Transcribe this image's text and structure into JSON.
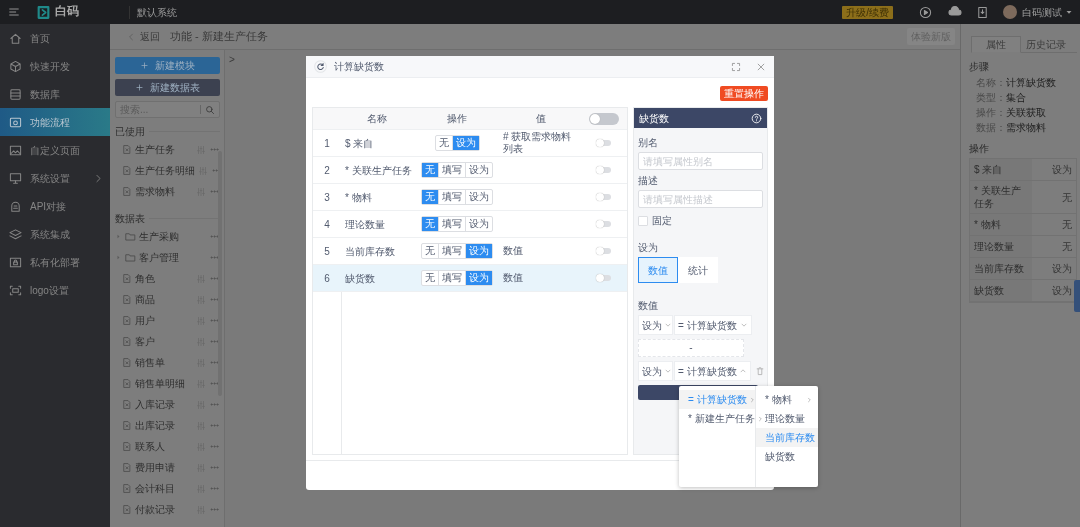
{
  "topbar": {
    "app_name": "白码",
    "system": "默认系统",
    "upgrade": "升级/续费",
    "user": "白码测试"
  },
  "sidebar": {
    "items": [
      {
        "label": "首页",
        "selected": false,
        "kind": "link"
      },
      {
        "label": "快速开发",
        "selected": false,
        "kind": "link"
      },
      {
        "label": "数据库",
        "selected": false,
        "kind": "link"
      },
      {
        "label": "功能流程",
        "selected": true,
        "kind": "link"
      },
      {
        "label": "自定义页面",
        "selected": false,
        "kind": "link"
      },
      {
        "label": "系统设置",
        "selected": false,
        "kind": "group"
      },
      {
        "label": "API对接",
        "selected": false,
        "kind": "link"
      },
      {
        "label": "系统集成",
        "selected": false,
        "kind": "link"
      },
      {
        "label": "私有化部署",
        "selected": false,
        "kind": "link"
      },
      {
        "label": "logo设置",
        "selected": false,
        "kind": "link"
      }
    ]
  },
  "breadcrumb": {
    "back": "返回",
    "title": "功能 - 新建生产任务",
    "action": "体验新版"
  },
  "tree": {
    "buttons": [
      {
        "label": "新建模块",
        "kind": "primary"
      },
      {
        "label": "新建数据表",
        "kind": "dark"
      }
    ],
    "search": {
      "placeholder": "搜索..."
    },
    "sections": [
      {
        "title": "已使用",
        "items": [
          {
            "label": "生产任务",
            "kind": "table"
          },
          {
            "label": "生产任务明细",
            "kind": "table"
          },
          {
            "label": "需求物料",
            "kind": "table"
          }
        ]
      },
      {
        "title": "数据表",
        "items": [
          {
            "label": "生产采购",
            "kind": "folder",
            "expanded": false
          },
          {
            "label": "客户管理",
            "kind": "folder",
            "expanded": false
          },
          {
            "label": "角色",
            "kind": "table"
          },
          {
            "label": "商品",
            "kind": "table"
          },
          {
            "label": "用户",
            "kind": "table"
          },
          {
            "label": "客户",
            "kind": "table"
          },
          {
            "label": "销售单",
            "kind": "table"
          },
          {
            "label": "销售单明细",
            "kind": "table"
          },
          {
            "label": "入库记录",
            "kind": "table"
          },
          {
            "label": "出库记录",
            "kind": "table"
          },
          {
            "label": "联系人",
            "kind": "table"
          },
          {
            "label": "费用申请",
            "kind": "table"
          },
          {
            "label": "会计科目",
            "kind": "table"
          },
          {
            "label": "付款记录",
            "kind": "table"
          }
        ]
      }
    ]
  },
  "canvas": {
    "expand_mark": ">"
  },
  "modal": {
    "title": "计算缺货数",
    "reset": "重置操作",
    "table": {
      "columns": [
        "名称",
        "操作",
        "值"
      ],
      "enabled": false,
      "rows": [
        {
          "index": "1",
          "name": "$ 来自",
          "ops": [
            {
              "label": "无",
              "selected": false
            },
            {
              "label": "设为",
              "selected": true
            }
          ],
          "value": "# 获取需求物料列表",
          "enabled": false,
          "selected": false
        },
        {
          "index": "2",
          "name": "* 关联生产任务",
          "ops": [
            {
              "label": "无",
              "selected": true
            },
            {
              "label": "填写",
              "selected": false
            },
            {
              "label": "设为",
              "selected": false
            }
          ],
          "enabled": false,
          "selected": false
        },
        {
          "index": "3",
          "name": "* 物料",
          "ops": [
            {
              "label": "无",
              "selected": true
            },
            {
              "label": "填写",
              "selected": false
            },
            {
              "label": "设为",
              "selected": false
            }
          ],
          "enabled": false,
          "selected": false
        },
        {
          "index": "4",
          "name": "理论数量",
          "ops": [
            {
              "label": "无",
              "selected": true
            },
            {
              "label": "填写",
              "selected": false
            },
            {
              "label": "设为",
              "selected": false
            }
          ],
          "enabled": false,
          "selected": false
        },
        {
          "index": "5",
          "name": "当前库存数",
          "ops": [
            {
              "label": "无",
              "selected": false
            },
            {
              "label": "填写",
              "selected": false
            },
            {
              "label": "设为",
              "selected": true
            }
          ],
          "value": "数值",
          "enabled": false,
          "selected": false
        },
        {
          "index": "6",
          "name": "缺货数",
          "ops": [
            {
              "label": "无",
              "selected": false
            },
            {
              "label": "填写",
              "selected": false
            },
            {
              "label": "设为",
              "selected": true
            }
          ],
          "value": "数值",
          "enabled": false,
          "selected": true
        }
      ]
    },
    "panel": {
      "title": "缺货数",
      "alias": {
        "label": "别名",
        "placeholder": "请填写属性别名"
      },
      "description": {
        "label": "描述",
        "placeholder": "请填写属性描述"
      },
      "fixed": {
        "label": "固定",
        "checked": false
      },
      "set_as": {
        "label": "设为",
        "options": [
          {
            "label": "数值",
            "selected": true
          },
          {
            "label": "统计",
            "selected": false
          }
        ]
      },
      "value": {
        "label": "数值",
        "rows": [
          {
            "mode": "设为",
            "target": "= 计算缺货数",
            "expanded": false
          },
          {
            "mode": "设为",
            "target": "= 计算缺货数",
            "expanded": true
          }
        ],
        "separator": "-"
      }
    },
    "dropdown": {
      "columns": [
        [
          {
            "label": "= 计算缺货数",
            "has_children": true,
            "selected": true
          },
          {
            "label": "* 新建生产任务",
            "has_children": true,
            "selected": false
          }
        ],
        [
          {
            "label": "* 物料",
            "has_children": true,
            "selected": false
          },
          {
            "label": "理论数量",
            "has_children": false,
            "selected": false
          },
          {
            "label": "当前库存数",
            "has_children": false,
            "selected": true
          },
          {
            "label": "缺货数",
            "has_children": false,
            "selected": false
          }
        ]
      ]
    }
  },
  "right_panel": {
    "tabs": [
      {
        "label": "属性",
        "selected": true
      },
      {
        "label": "历史记录",
        "selected": false
      }
    ],
    "step": {
      "title": "步骤",
      "fields": [
        {
          "label": "名称：",
          "value": "计算缺货数"
        },
        {
          "label": "类型：",
          "value": "集合"
        },
        {
          "label": "操作：",
          "value": "关联获取"
        },
        {
          "label": "数据：",
          "value": "需求物料"
        }
      ]
    },
    "operations": {
      "title": "操作",
      "rows": [
        {
          "name": "$ 来自",
          "value": "设为"
        },
        {
          "name": "* 关联生产任务",
          "value": "无"
        },
        {
          "name": "* 物料",
          "value": "无"
        },
        {
          "name": "理论数量",
          "value": "无"
        },
        {
          "name": "当前库存数",
          "value": "设为"
        },
        {
          "name": "缺货数",
          "value": "设为"
        }
      ]
    }
  }
}
